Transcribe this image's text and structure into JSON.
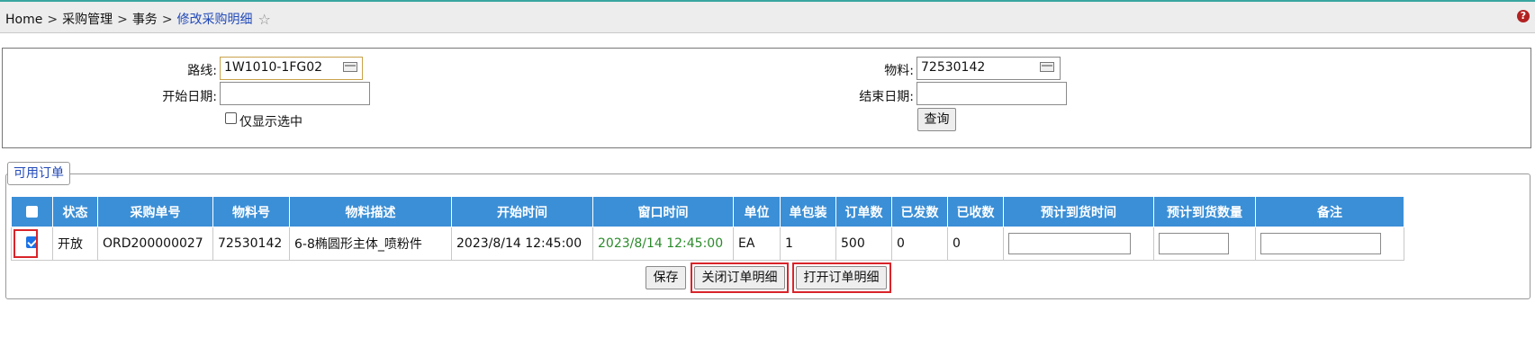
{
  "breadcrumb": {
    "items": [
      "Home",
      "采购管理",
      "事务"
    ],
    "separator": ">",
    "current": "修改采购明细"
  },
  "icons": {
    "favorite": "star-outline-icon",
    "help": "question-icon",
    "picker": "lookup-icon"
  },
  "help_glyph": "?",
  "star_glyph": "☆",
  "filter": {
    "route_label": "路线:",
    "route_value": "1W1010-1FG02",
    "material_label": "物料:",
    "material_value": "72530142",
    "start_date_label": "开始日期:",
    "start_date_value": "",
    "end_date_label": "结束日期:",
    "end_date_value": "",
    "only_selected_label": "仅显示选中",
    "query_button": "查询"
  },
  "orders": {
    "legend": "可用订单",
    "columns": [
      "状态",
      "采购单号",
      "物料号",
      "物料描述",
      "开始时间",
      "窗口时间",
      "单位",
      "单包装",
      "订单数",
      "已发数",
      "已收数",
      "预计到货时间",
      "预计到货数量",
      "备注"
    ],
    "rows": [
      {
        "checked": true,
        "status": "开放",
        "po_number": "ORD200000027",
        "material_no": "72530142",
        "description": "6-8椭圆形主体_喷粉件",
        "start_time": "2023/8/14 12:45:00",
        "window_time": "2023/8/14 12:45:00",
        "unit": "EA",
        "pack_qty": "1",
        "order_qty": "500",
        "shipped_qty": "0",
        "received_qty": "0",
        "eta": "",
        "eta_qty": "",
        "remark": ""
      }
    ],
    "buttons": {
      "save": "保存",
      "close_detail": "关闭订单明细",
      "open_detail": "打开订单明细"
    }
  },
  "colors": {
    "header_bg": "#3b8fd6",
    "highlight": "#d9242a",
    "link": "#2149b8",
    "window_time": "#2b8a2b"
  }
}
